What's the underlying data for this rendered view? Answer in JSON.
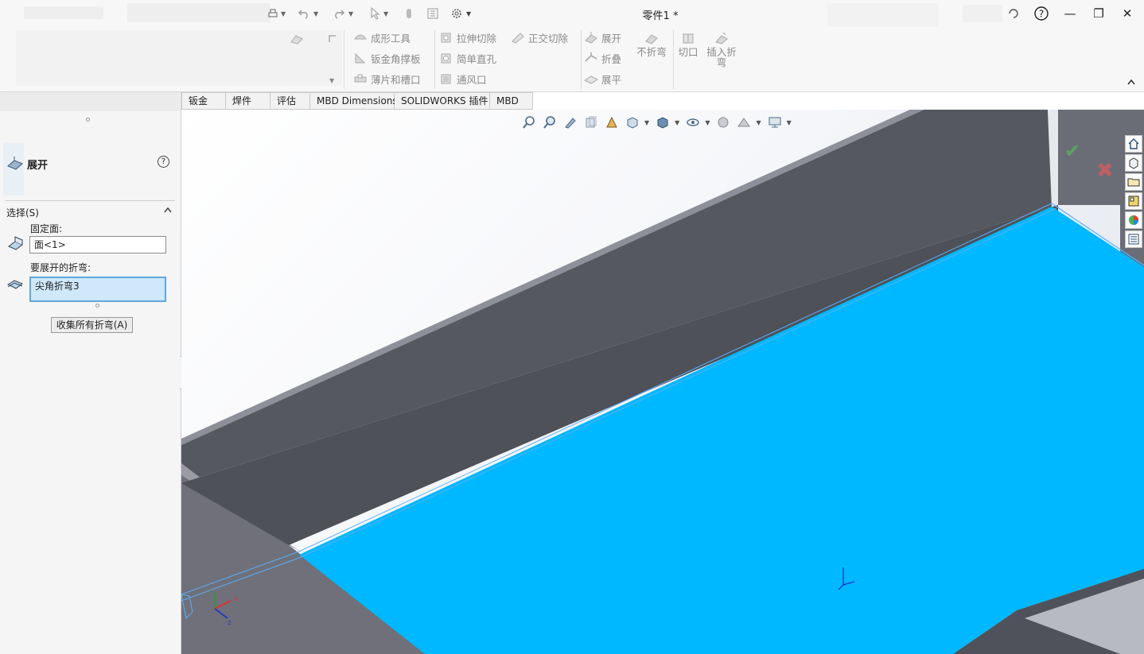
{
  "app": {
    "document_title": "零件1 *"
  },
  "window_controls": {
    "search_icon": "search-icon",
    "help": "?",
    "minimize": "—",
    "restore": "❐",
    "close": "✕"
  },
  "ribbon": {
    "group_forming": {
      "items": [
        "成形工具",
        "钣金角撑板",
        "薄片和槽口"
      ]
    },
    "group_cuts": {
      "items": [
        "拉伸切除",
        "简单直孔",
        "通风口"
      ],
      "side_item": "正交切除"
    },
    "group_bends": {
      "items": [
        "展开",
        "折叠",
        "展平"
      ],
      "big_item": "不折弯"
    },
    "group_rip": {
      "cut": "切口",
      "insert_bend_line1": "插入折",
      "insert_bend_line2": "弯"
    },
    "collapse_icon": "chevron-up-icon"
  },
  "tabs": [
    {
      "label": "钣金"
    },
    {
      "label": "焊件"
    },
    {
      "label": "评估"
    },
    {
      "label": "MBD Dimensions"
    },
    {
      "label": "SOLIDWORKS 插件"
    },
    {
      "label": "MBD"
    }
  ],
  "property_manager": {
    "title": "展开",
    "help": "?",
    "section_title": "选择(S)",
    "fixed_face_label": "固定面:",
    "fixed_face_value": "面<1>",
    "bends_label": "要展开的折弯:",
    "bends_value": "尖角折弯3",
    "collect_button": "收集所有折弯(A)"
  },
  "viewport": {
    "confirm_icon": "checkmark-icon",
    "cancel_icon": "cross-icon",
    "colors": {
      "selected_face": "#00b8ff",
      "sheet_dark": "#55585f",
      "sheet_side": "#7a7d86"
    }
  }
}
